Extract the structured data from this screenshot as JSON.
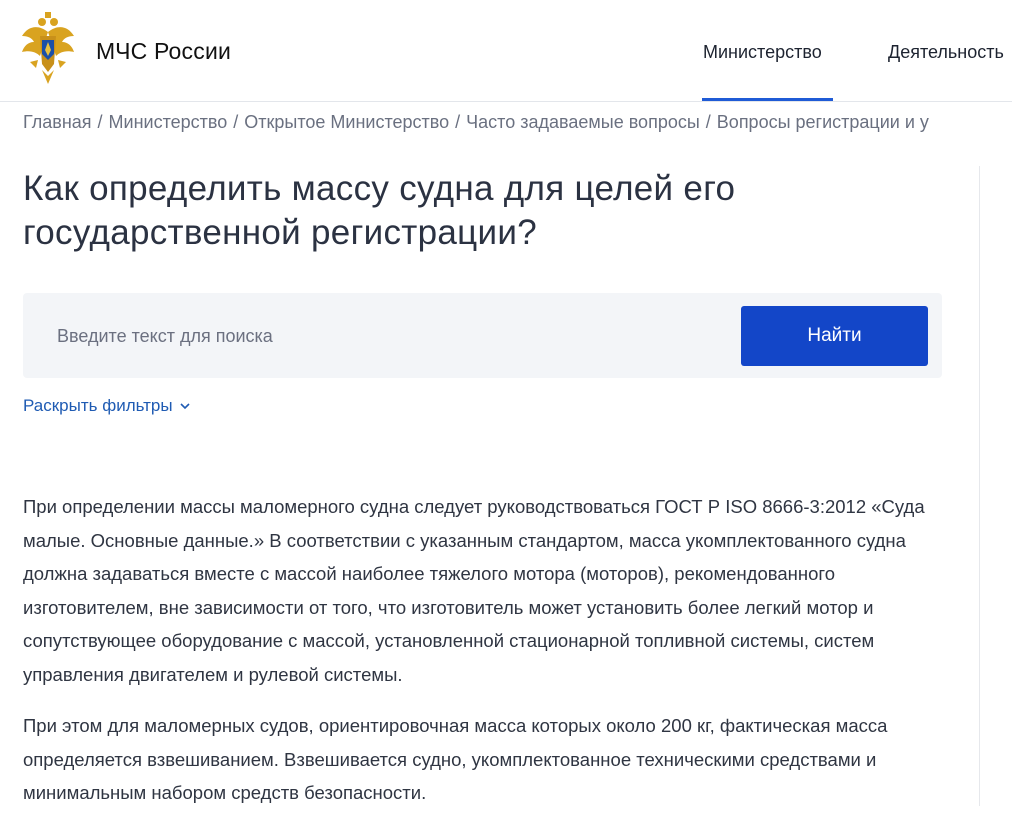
{
  "header": {
    "brand": "МЧС России",
    "nav": {
      "ministry": "Министерство",
      "activity": "Деятельность"
    }
  },
  "breadcrumb": [
    "Главная",
    "Министерство",
    "Открытое Министерство",
    "Часто задаваемые вопросы",
    "Вопросы регистрации и у"
  ],
  "breadcrumb_separator": "/",
  "page": {
    "title": "Как определить массу судна для целей его государственной регистрации?"
  },
  "search": {
    "placeholder": "Введите текст для поиска",
    "button_label": "Найти"
  },
  "filters": {
    "toggle_label": "Раскрыть фильтры"
  },
  "content": {
    "paragraph1": "При определении массы маломерного судна следует руководствоваться ГОСТ Р ISO 8666-3:2012 «Суда малые. Основные данные.» В соответствии с указанным стандартом, масса укомплектованного судна должна задаваться вместе с массой наиболее тяжелого мотора (моторов), рекомендованного изготовителем, вне зависимости от того, что изготовитель может установить более легкий мотор и сопутствующее оборудование с массой, установленной стационарной топливной системы, систем управления двигателем и рулевой системы.",
    "paragraph2": "При этом для маломерных судов, ориентировочная масса которых около 200 кг, фактическая масса определяется взвешиванием. Взвешивается судно, укомплектованное техническими средствами и минимальным набором средств безопасности."
  },
  "colors": {
    "accent": "#1f5bd6",
    "button": "#1346c8",
    "link": "#1f5bb3",
    "panel": "#f3f5f8"
  }
}
